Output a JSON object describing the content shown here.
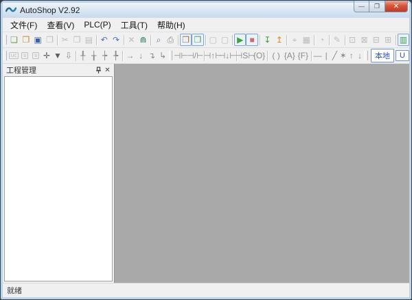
{
  "window": {
    "title": "AutoShop V2.92",
    "controls": {
      "minimize": "—",
      "maximize": "❐",
      "close": "✕"
    }
  },
  "menu": {
    "items": [
      {
        "name": "file",
        "label": "文件(F)"
      },
      {
        "name": "view",
        "label": "查看(V)"
      },
      {
        "name": "plc",
        "label": "PLC(P)"
      },
      {
        "name": "tools",
        "label": "工具(T)"
      },
      {
        "name": "help",
        "label": "帮助(H)"
      }
    ]
  },
  "toolbar_main": {
    "items": [
      {
        "type": "grip"
      },
      {
        "type": "btn",
        "name": "new-file",
        "glyph": "❏",
        "color": "#6f9c4a"
      },
      {
        "type": "btn",
        "name": "open-project",
        "glyph": "❐",
        "color": "#c8862a"
      },
      {
        "type": "btn",
        "name": "save",
        "glyph": "▣",
        "color": "#3a5fa8"
      },
      {
        "type": "btn",
        "name": "save-all",
        "glyph": "❐",
        "state": "disabled"
      },
      {
        "type": "sep"
      },
      {
        "type": "btn",
        "name": "cut",
        "glyph": "✂",
        "state": "disabled"
      },
      {
        "type": "btn",
        "name": "copy",
        "glyph": "❐",
        "state": "disabled"
      },
      {
        "type": "btn",
        "name": "paste",
        "glyph": "▤",
        "state": "disabled"
      },
      {
        "type": "sep"
      },
      {
        "type": "btn",
        "name": "undo",
        "glyph": "↶",
        "color": "#4a72c4"
      },
      {
        "type": "btn",
        "name": "redo",
        "glyph": "↷",
        "color": "#4a72c4"
      },
      {
        "type": "sep"
      },
      {
        "type": "btn",
        "name": "delete",
        "glyph": "✕",
        "state": "disabled"
      },
      {
        "type": "btn",
        "name": "find",
        "glyph": "⋒",
        "color": "#2e7d6e"
      },
      {
        "type": "sep"
      },
      {
        "type": "btn",
        "name": "zoom",
        "glyph": "⌕",
        "color": "#5a7a9a"
      },
      {
        "type": "btn",
        "name": "print",
        "glyph": "⎙",
        "color": "#8a8a8a"
      },
      {
        "type": "sep"
      },
      {
        "type": "btn",
        "name": "project-window-toggle",
        "glyph": "❒",
        "color": "#a5702a",
        "state": "active"
      },
      {
        "type": "btn",
        "name": "output-window-toggle",
        "glyph": "❒",
        "color": "#5a9a4a",
        "state": "active"
      },
      {
        "type": "sep"
      },
      {
        "type": "btn",
        "name": "element-monitor",
        "glyph": "▢",
        "state": "disabled"
      },
      {
        "type": "btn",
        "name": "data-monitor",
        "glyph": "▢",
        "state": "disabled"
      },
      {
        "type": "sep"
      },
      {
        "type": "btn",
        "name": "run-plc",
        "glyph": "▶",
        "color": "#3aa53a",
        "state": "active"
      },
      {
        "type": "btn",
        "name": "stop-plc",
        "glyph": "■",
        "color": "#d06a72",
        "state": "active"
      },
      {
        "type": "sep"
      },
      {
        "type": "btn",
        "name": "download-program",
        "glyph": "↧",
        "color": "#3a9a3a"
      },
      {
        "type": "btn",
        "name": "upload-program",
        "glyph": "↥",
        "color": "#d08a2a"
      },
      {
        "type": "sep"
      },
      {
        "type": "btn",
        "name": "monitor-mode",
        "glyph": "⌖",
        "state": "disabled"
      },
      {
        "type": "btn",
        "name": "monitor-screen",
        "glyph": "▦",
        "state": "disabled"
      },
      {
        "type": "sep"
      },
      {
        "type": "btn",
        "name": "compass-tool",
        "glyph": "◔",
        "state": "disabled"
      },
      {
        "type": "sep"
      },
      {
        "type": "btn",
        "name": "pencil-edit",
        "glyph": "✎",
        "state": "disabled"
      },
      {
        "type": "sep"
      },
      {
        "type": "btn",
        "name": "monitor-dot",
        "glyph": "⊡",
        "state": "disabled"
      },
      {
        "type": "btn",
        "name": "monitor-clip",
        "glyph": "⊠",
        "state": "disabled"
      },
      {
        "type": "btn",
        "name": "monitor-rows",
        "glyph": "⊟",
        "state": "disabled"
      },
      {
        "type": "btn",
        "name": "monitor-cols",
        "glyph": "⊞",
        "state": "disabled"
      },
      {
        "type": "sep"
      },
      {
        "type": "btn",
        "name": "chart-view",
        "glyph": "▥",
        "color": "#4a9a5a",
        "state": "active"
      }
    ]
  },
  "toolbar_ladder": {
    "items": [
      {
        "type": "grip"
      },
      {
        "type": "btn",
        "name": "uc-block",
        "glyph": "uc",
        "boxed": true,
        "state": "disabled"
      },
      {
        "type": "btn",
        "name": "s-block-1",
        "glyph": "s",
        "boxed": true,
        "state": "disabled"
      },
      {
        "type": "btn",
        "name": "s-block-2",
        "glyph": "s",
        "boxed": true,
        "state": "disabled"
      },
      {
        "type": "btn",
        "name": "insert-cross",
        "glyph": "✛",
        "color": "#5c5c5c"
      },
      {
        "type": "btn",
        "name": "insert-row-below",
        "glyph": "▼",
        "color": "#5c5c5c"
      },
      {
        "type": "btn",
        "name": "delete-row",
        "glyph": "⇩",
        "state": "dark"
      },
      {
        "type": "sep"
      },
      {
        "type": "btn",
        "name": "ladder-insert-cell",
        "glyph": "╀",
        "state": "dark"
      },
      {
        "type": "btn",
        "name": "ladder-insert-row",
        "glyph": "╁",
        "state": "dark"
      },
      {
        "type": "btn",
        "name": "ladder-append-cell",
        "glyph": "┾",
        "state": "dark"
      },
      {
        "type": "btn",
        "name": "ladder-append-row",
        "glyph": "╄",
        "state": "dark"
      },
      {
        "type": "sep"
      },
      {
        "type": "btn",
        "name": "line-right",
        "glyph": "→",
        "state": "dark"
      },
      {
        "type": "btn",
        "name": "line-down",
        "glyph": "↓",
        "state": "dark"
      },
      {
        "type": "btn",
        "name": "line-corner-down",
        "glyph": "↴",
        "state": "dark"
      },
      {
        "type": "btn",
        "name": "line-corner-up",
        "glyph": "↳",
        "state": "dark"
      },
      {
        "type": "grip"
      },
      {
        "type": "btn",
        "name": "contact-open",
        "glyph": "⊣⊢",
        "wide": true,
        "state": "dark"
      },
      {
        "type": "btn",
        "name": "contact-closed",
        "glyph": "⊣/⊢",
        "wide": true,
        "state": "dark"
      },
      {
        "type": "sep"
      },
      {
        "type": "btn",
        "name": "contact-rising-edge",
        "glyph": "⊣↑⊢",
        "wide": true,
        "state": "dark"
      },
      {
        "type": "btn",
        "name": "contact-falling-edge",
        "glyph": "⊣↓⊢",
        "wide": true,
        "state": "dark"
      },
      {
        "type": "sep"
      },
      {
        "type": "btn",
        "name": "contact-set",
        "glyph": "⊣S⊢",
        "wide": true,
        "state": "dark"
      },
      {
        "type": "btn",
        "name": "coil-out",
        "glyph": "{O}",
        "wide": true,
        "state": "dark"
      },
      {
        "type": "sep"
      },
      {
        "type": "btn",
        "name": "coil",
        "glyph": "( )",
        "wide": true,
        "state": "dark"
      },
      {
        "type": "btn",
        "name": "coil-a",
        "glyph": "{A}",
        "wide": true,
        "state": "dark"
      },
      {
        "type": "btn",
        "name": "coil-f",
        "glyph": "{F}",
        "wide": true,
        "state": "dark"
      },
      {
        "type": "sep"
      },
      {
        "type": "btn",
        "name": "draw-hline",
        "glyph": "—",
        "narrow": true,
        "state": "dark"
      },
      {
        "type": "btn",
        "name": "draw-vline",
        "glyph": "|",
        "narrow": true,
        "state": "dark"
      },
      {
        "type": "btn",
        "name": "erase-line",
        "glyph": "╱",
        "narrow": true,
        "state": "dark"
      },
      {
        "type": "btn",
        "name": "erase-star",
        "glyph": "✶",
        "narrow": true,
        "state": "dark"
      },
      {
        "type": "btn",
        "name": "move-up",
        "glyph": "↑",
        "narrow": true,
        "state": "dark"
      },
      {
        "type": "btn",
        "name": "move-down",
        "glyph": "↓",
        "narrow": true,
        "state": "dark"
      },
      {
        "type": "grip"
      },
      {
        "type": "textbtn",
        "name": "local-mode",
        "label": "本地",
        "state": "active"
      },
      {
        "type": "textbtn",
        "name": "usb-mode",
        "label": "U"
      }
    ]
  },
  "panel": {
    "title": "工程管理",
    "close_glyph": "✕"
  },
  "statusbar": {
    "text": "就绪"
  },
  "colors": {
    "canvas_gray": "#a9a9a9",
    "aero_frame": "#bdd1e7",
    "active_border": "#7da2ce",
    "local_button_text": "#2a50c8",
    "run_green": "#3aa53a",
    "stop_red": "#d06a72"
  }
}
